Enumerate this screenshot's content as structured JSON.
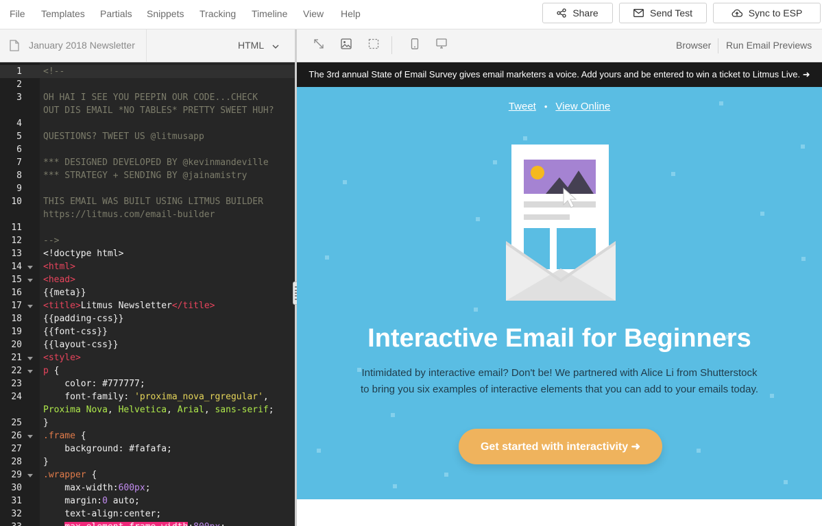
{
  "menu": {
    "items": [
      "File",
      "Templates",
      "Partials",
      "Snippets",
      "Tracking",
      "Timeline",
      "View",
      "Help"
    ],
    "share_label": "Share",
    "send_test_label": "Send Test",
    "sync_label": "Sync to ESP"
  },
  "editor_toolbar": {
    "file_name": "January 2018 Newsletter",
    "language": "HTML"
  },
  "preview_toolbar": {
    "icons": [
      "expand-icon",
      "image-icon",
      "select-icon",
      "mobile-icon",
      "desktop-icon"
    ],
    "browser_label": "Browser",
    "previews_label": "Run Email Previews"
  },
  "code_lines": [
    {
      "n": "1",
      "fold": false,
      "hl": true,
      "segs": [
        {
          "t": "<!--",
          "c": "comment"
        }
      ]
    },
    {
      "n": "2",
      "fold": false,
      "segs": []
    },
    {
      "n": "3",
      "fold": false,
      "segs": [
        {
          "t": "OH HAI I SEE YOU PEEPIN OUR CODE...CHECK",
          "c": "comment"
        }
      ]
    },
    {
      "n": "",
      "fold": false,
      "segs": [
        {
          "t": "OUT DIS EMAIL *NO TABLES* PRETTY SWEET HUH?",
          "c": "comment"
        }
      ]
    },
    {
      "n": "4",
      "fold": false,
      "segs": []
    },
    {
      "n": "5",
      "fold": false,
      "segs": [
        {
          "t": "QUESTIONS? TWEET US @litmusapp",
          "c": "comment"
        }
      ]
    },
    {
      "n": "6",
      "fold": false,
      "segs": []
    },
    {
      "n": "7",
      "fold": false,
      "segs": [
        {
          "t": "*** DESIGNED DEVELOPED BY @kevinmandeville",
          "c": "comment"
        }
      ]
    },
    {
      "n": "8",
      "fold": false,
      "segs": [
        {
          "t": "*** STRATEGY + SENDING BY @jainamistry",
          "c": "comment"
        }
      ]
    },
    {
      "n": "9",
      "fold": false,
      "segs": []
    },
    {
      "n": "10",
      "fold": false,
      "segs": [
        {
          "t": "THIS EMAIL WAS BUILT USING LITMUS BUILDER",
          "c": "comment"
        }
      ]
    },
    {
      "n": "",
      "fold": false,
      "segs": [
        {
          "t": "https://litmus.com/email-builder",
          "c": "comment"
        }
      ]
    },
    {
      "n": "11",
      "fold": false,
      "segs": []
    },
    {
      "n": "12",
      "fold": false,
      "segs": [
        {
          "t": "-->",
          "c": "comment"
        }
      ]
    },
    {
      "n": "13",
      "fold": false,
      "segs": [
        {
          "t": "<!doctype html>",
          "c": "plain"
        }
      ]
    },
    {
      "n": "14",
      "fold": true,
      "segs": [
        {
          "t": "<html>",
          "c": "tag"
        }
      ]
    },
    {
      "n": "15",
      "fold": true,
      "segs": [
        {
          "t": "<head>",
          "c": "tag"
        }
      ]
    },
    {
      "n": "16",
      "fold": false,
      "segs": [
        {
          "t": "{{meta}}",
          "c": "plain"
        }
      ]
    },
    {
      "n": "17",
      "fold": true,
      "segs": [
        {
          "t": "<title>",
          "c": "tag"
        },
        {
          "t": "Litmus Newsletter",
          "c": "plain"
        },
        {
          "t": "</title>",
          "c": "tag"
        }
      ]
    },
    {
      "n": "18",
      "fold": false,
      "segs": [
        {
          "t": "{{padding-css}}",
          "c": "plain"
        }
      ]
    },
    {
      "n": "19",
      "fold": false,
      "segs": [
        {
          "t": "{{font-css}}",
          "c": "plain"
        }
      ]
    },
    {
      "n": "20",
      "fold": false,
      "segs": [
        {
          "t": "{{layout-css}}",
          "c": "plain"
        }
      ]
    },
    {
      "n": "21",
      "fold": true,
      "segs": [
        {
          "t": "<style>",
          "c": "tag"
        }
      ]
    },
    {
      "n": "22",
      "fold": true,
      "segs": [
        {
          "t": "p",
          "c": "tag"
        },
        {
          "t": " {",
          "c": "plain"
        }
      ]
    },
    {
      "n": "23",
      "fold": false,
      "segs": [
        {
          "t": "    color: ",
          "c": "plain"
        },
        {
          "t": "#777777",
          "c": "plain"
        },
        {
          "t": ";",
          "c": "plain"
        }
      ]
    },
    {
      "n": "24",
      "fold": false,
      "segs": [
        {
          "t": "    font-family: ",
          "c": "plain"
        },
        {
          "t": "'proxima_nova_rgregular'",
          "c": "str"
        },
        {
          "t": ",",
          "c": "plain"
        }
      ]
    },
    {
      "n": "",
      "fold": false,
      "segs": [
        {
          "t": "Proxima Nova",
          "c": "val"
        },
        {
          "t": ", ",
          "c": "plain"
        },
        {
          "t": "Helvetica",
          "c": "val"
        },
        {
          "t": ", ",
          "c": "plain"
        },
        {
          "t": "Arial",
          "c": "val"
        },
        {
          "t": ", ",
          "c": "plain"
        },
        {
          "t": "sans-serif",
          "c": "val"
        },
        {
          "t": ";",
          "c": "plain"
        }
      ]
    },
    {
      "n": "25",
      "fold": false,
      "segs": [
        {
          "t": "}",
          "c": "plain"
        }
      ]
    },
    {
      "n": "26",
      "fold": true,
      "segs": [
        {
          "t": ".frame",
          "c": "sel"
        },
        {
          "t": " {",
          "c": "plain"
        }
      ]
    },
    {
      "n": "27",
      "fold": false,
      "segs": [
        {
          "t": "    background: ",
          "c": "plain"
        },
        {
          "t": "#fafafa",
          "c": "plain"
        },
        {
          "t": ";",
          "c": "plain"
        }
      ]
    },
    {
      "n": "28",
      "fold": false,
      "segs": [
        {
          "t": "}",
          "c": "plain"
        }
      ]
    },
    {
      "n": "29",
      "fold": true,
      "segs": [
        {
          "t": ".wrapper",
          "c": "sel"
        },
        {
          "t": " {",
          "c": "plain"
        }
      ]
    },
    {
      "n": "30",
      "fold": false,
      "segs": [
        {
          "t": "    max-width:",
          "c": "plain"
        },
        {
          "t": "600px",
          "c": "num"
        },
        {
          "t": ";",
          "c": "plain"
        }
      ]
    },
    {
      "n": "31",
      "fold": false,
      "segs": [
        {
          "t": "    margin:",
          "c": "plain"
        },
        {
          "t": "0",
          "c": "num"
        },
        {
          "t": " auto;",
          "c": "plain"
        }
      ]
    },
    {
      "n": "32",
      "fold": false,
      "segs": [
        {
          "t": "    text-align:center;",
          "c": "plain"
        }
      ]
    },
    {
      "n": "33",
      "fold": false,
      "segs": [
        {
          "t": "    ",
          "c": "plain"
        },
        {
          "t": "max-element-frame-width",
          "c": "err"
        },
        {
          "t": ":",
          "c": "plain"
        },
        {
          "t": "800px",
          "c": "num"
        },
        {
          "t": ";",
          "c": "plain"
        }
      ]
    }
  ],
  "email": {
    "announcement": "The 3rd annual State of Email Survey gives email marketers a voice. Add yours and be entered to win a ticket to Litmus Live. ➜",
    "tweet_link": "Tweet",
    "separator": "•",
    "view_online_link": "View Online",
    "headline": "Interactive Email for Beginners",
    "body": "Intimidated by interactive email? Don't be! We partnered with Alice Li from Shutterstock to bring you six examples of interactive elements that you can add to your emails today.",
    "cta_label": "Get started with interactivity ➜"
  },
  "colors": {
    "hero_bg": "#5abde3",
    "cta_bg": "#efb35d",
    "announce_bg": "#1a1a1a",
    "editor_bg": "#262626"
  }
}
